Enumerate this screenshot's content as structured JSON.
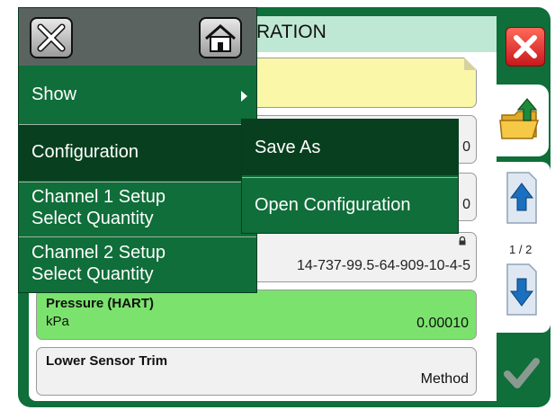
{
  "header": {
    "title": "RATION"
  },
  "fields": {
    "value1": "0",
    "value2": "0",
    "address": "14-737-99.5-64-909-10-4-5"
  },
  "pressure": {
    "title": "Pressure (HART)",
    "unit": "kPa",
    "value": "0.00010"
  },
  "trim": {
    "title": "Lower Sensor Trim",
    "value": "Method"
  },
  "scroll": {
    "page": "1 / 2"
  },
  "menu": {
    "show_label": "Show",
    "configuration_label": "Configuration",
    "channel1_line1": "Channel 1 Setup",
    "channel1_line2": "Select Quantity",
    "channel2_line1": "Channel 2 Setup",
    "channel2_line2": "Select Quantity"
  },
  "submenu": {
    "save_as": "Save As",
    "open_configuration": "Open Configuration"
  },
  "icons": {
    "menu_close": "close-icon",
    "menu_home": "home-icon",
    "side_close": "close-icon",
    "folder": "folder-upload-icon",
    "scroll_up": "page-up-icon",
    "scroll_down": "page-down-icon",
    "ok": "check-icon",
    "lock": "lock-icon"
  },
  "colors": {
    "frame": "#0f6e39",
    "menu_dark": "#08401f",
    "title_bar": "#bfe8d4",
    "pressure_card": "#7be36d",
    "note_card": "#fbf7a9",
    "close_red": "#d9252a"
  }
}
